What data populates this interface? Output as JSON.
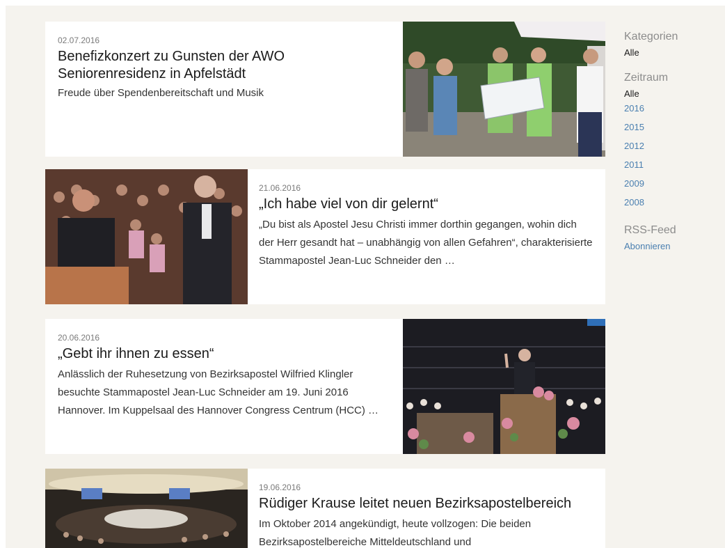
{
  "articles": [
    {
      "date": "02.07.2016",
      "title": "Benefizkonzert zu Gunsten der AWO Seniorenresidenz in Apfelstädt",
      "teaser": "Freude über Spendenbereitschaft und Musik"
    },
    {
      "date": "21.06.2016",
      "title": "„Ich habe viel von dir gelernt“",
      "teaser": "„Du bist als Apostel Jesu Christi immer dorthin gegangen, wohin dich der Herr gesandt hat – unabhängig von allen Gefahren“, charakterisierte Stammapostel Jean-Luc Schneider den …"
    },
    {
      "date": "20.06.2016",
      "title": "„Gebt ihr ihnen zu essen“",
      "teaser": "Anlässlich der Ruhesetzung von Bezirksapostel Wilfried Klingler besuchte Stammapostel Jean-Luc Schneider am 19. Juni 2016 Hannover. Im Kuppelsaal des Hannover Congress Centrum (HCC) …"
    },
    {
      "date": "19.06.2016",
      "title": "Rüdiger Krause leitet neuen Bezirksapostelbereich",
      "teaser": "Im Oktober 2014 angekündigt, heute vollzogen: Die beiden Bezirksapostelbereiche Mitteldeutschland und"
    }
  ],
  "sidebar": {
    "kategorien": {
      "heading": "Kategorien",
      "alle": "Alle"
    },
    "zeitraum": {
      "heading": "Zeitraum",
      "alle": "Alle",
      "years": [
        "2016",
        "2015",
        "2012",
        "2011",
        "2009",
        "2008"
      ]
    },
    "rss": {
      "heading": "RSS-Feed",
      "link": "Abonnieren"
    }
  },
  "colors": {
    "page_background": "#f5f3ee",
    "link": "#4a7fb0",
    "heading_muted": "#8c8c8c"
  }
}
